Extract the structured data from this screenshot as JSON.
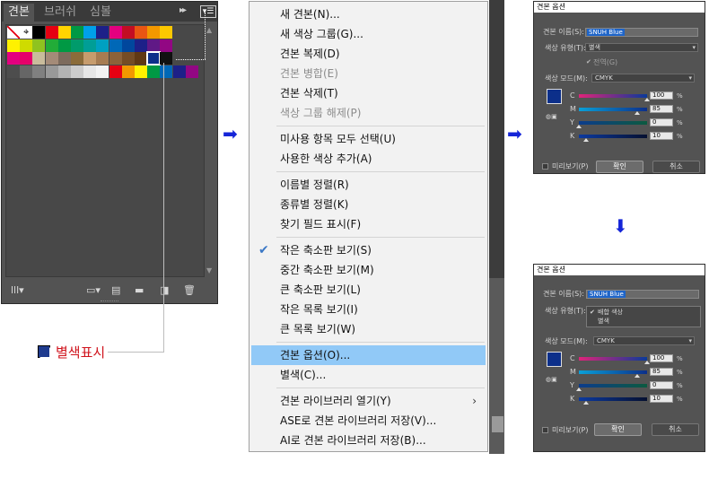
{
  "swatches_panel": {
    "tabs": [
      {
        "label": "견본"
      },
      {
        "label": "브러쉬"
      },
      {
        "label": "심볼"
      }
    ],
    "forward_glyph": "▸▸",
    "menu_glyph": "▾☰",
    "rows": [
      [
        "#ffffff",
        "#ffffff",
        "#000000",
        "#e60012",
        "#ffd400",
        "#009944",
        "#00a0e9",
        "#1d2088",
        "#e4007f",
        "#c30d23",
        "#e95513",
        "#f39800",
        "#fcc800"
      ],
      [
        "#fff100",
        "#cfdb00",
        "#8fc31f",
        "#22ac38",
        "#009944",
        "#009b6b",
        "#009e96",
        "#00a0c1",
        "#0068b7",
        "#00479d",
        "#1d2088",
        "#601986",
        "#920783"
      ],
      [
        "#e4007f",
        "#e5006a",
        "#c9bc9c",
        "#a48b78",
        "#7d6b5d",
        "#8b6c3a",
        "#c69c6d",
        "#a67c52",
        "#8c6239",
        "#754c24",
        "#603813",
        "#0c2f8a",
        "#111111"
      ],
      [
        "#4d4d4d",
        "#666666",
        "#808080",
        "#999999",
        "#b3b3b3",
        "#cccccc",
        "#e6e6e6",
        "#f2f2f2",
        "#e60012",
        "#f39800",
        "#fff100",
        "#009944",
        "#0068b7",
        "#1d2088",
        "#920783"
      ]
    ]
  },
  "callout": {
    "label": "별색표시"
  },
  "menu": {
    "groups": [
      [
        {
          "label": "새 견본(N)...",
          "state": "normal"
        },
        {
          "label": "새 색상 그룹(G)...",
          "state": "normal"
        },
        {
          "label": "견본 복제(D)",
          "state": "normal"
        },
        {
          "label": "견본 병합(E)",
          "state": "disabled"
        },
        {
          "label": "견본 삭제(T)",
          "state": "normal"
        },
        {
          "label": "색상 그룹 해제(P)",
          "state": "disabled"
        }
      ],
      [
        {
          "label": "미사용 항목 모두 선택(U)",
          "state": "normal"
        },
        {
          "label": "사용한 색상 추가(A)",
          "state": "normal"
        }
      ],
      [
        {
          "label": "이름별 정렬(R)",
          "state": "normal"
        },
        {
          "label": "종류별 정렬(K)",
          "state": "normal"
        },
        {
          "label": "찾기 필드 표시(F)",
          "state": "normal"
        }
      ],
      [
        {
          "label": "작은 축소판 보기(S)",
          "state": "checked"
        },
        {
          "label": "중간 축소판 보기(M)",
          "state": "normal"
        },
        {
          "label": "큰 축소판 보기(L)",
          "state": "normal"
        },
        {
          "label": "작은 목록 보기(I)",
          "state": "normal"
        },
        {
          "label": "큰 목록 보기(W)",
          "state": "normal"
        }
      ],
      [
        {
          "label": "견본 옵션(O)...",
          "state": "highlighted"
        },
        {
          "label": "별색(C)...",
          "state": "normal"
        }
      ],
      [
        {
          "label": "견본 라이브러리 열기(Y)",
          "state": "submenu"
        },
        {
          "label": "ASE로 견본 라이브러리 저장(V)...",
          "state": "normal"
        },
        {
          "label": "AI로 견본 라이브러리 저장(B)...",
          "state": "normal"
        }
      ]
    ]
  },
  "dialog": {
    "title": "견본 옵션",
    "name_label": "견본 이름(S):",
    "name_value": "SNUH Blue",
    "type_label": "색상 유형(T):",
    "type_value": "별색",
    "global_label": "전역(G)",
    "mode_label": "색상 모드(M):",
    "mode_value": "CMYK",
    "channels": [
      {
        "name": "C",
        "value": "100",
        "unit": "%",
        "fraction": 1.0
      },
      {
        "name": "M",
        "value": "85",
        "unit": "%",
        "fraction": 0.85
      },
      {
        "name": "Y",
        "value": "0",
        "unit": "%",
        "fraction": 0.0
      },
      {
        "name": "K",
        "value": "10",
        "unit": "%",
        "fraction": 0.1
      }
    ],
    "preview_label": "미리보기(P)",
    "ok_label": "확인",
    "cancel_label": "취소",
    "type_options": [
      {
        "label": "배합 색상",
        "checked": true
      },
      {
        "label": "별색",
        "checked": false
      }
    ]
  },
  "arrows": {
    "right": "➡",
    "down": "⬇"
  }
}
